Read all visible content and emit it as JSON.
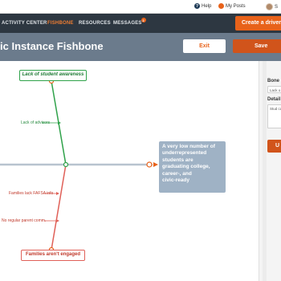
{
  "topbar": {
    "help": "Help",
    "help_icon": "question-circle-icon",
    "my_posts": "My Posts",
    "posts_icon": "posts-icon",
    "user_initial": "S",
    "user_icon": "user-avatar"
  },
  "nav": {
    "items": [
      "ACTIVITY CENTER",
      "FISHBONE",
      "RESOURCES",
      "MESSAGES"
    ],
    "active": "FISHBONE",
    "messages_badge": "2",
    "cta": "Create a driver d"
  },
  "titlebar": {
    "title": "ic Instance Fishbone",
    "exit": "Exit",
    "save": "Save"
  },
  "fishbone": {
    "top_cause": "Lack of student awareness",
    "top_sub": "Lack of advisors",
    "bottom_cause": "Families aren't engaged",
    "bottom_subs": [
      "Families lack FAFSA info",
      "No regular parent comm."
    ],
    "effect_lines": [
      "A very low number of",
      "underrepresented",
      "students are",
      "graduating college,",
      "career-, and",
      "civic-ready"
    ]
  },
  "panel": {
    "bone_label": "Bone",
    "bone_value": "Lack o",
    "details_label": "Detail",
    "details_value": "Stud care",
    "update_button": "U"
  },
  "colors": {
    "accent": "#e8621a",
    "nav_bg": "#2d3741",
    "title_bg": "#6b7b8c",
    "green_bone": "#2fa24a",
    "red_bone": "#e06058",
    "spine": "#b8c4cf",
    "effect_bg": "#9fb2c5"
  }
}
